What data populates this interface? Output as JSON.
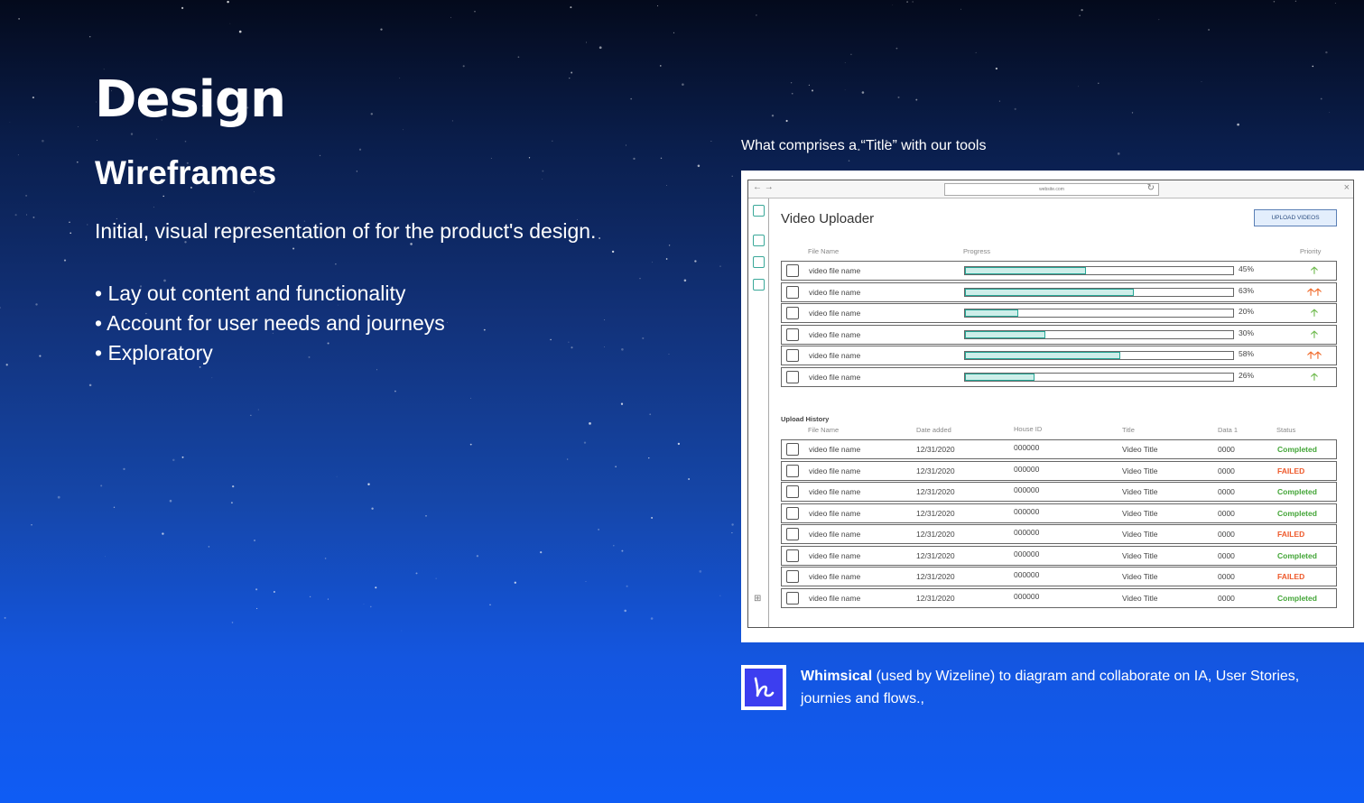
{
  "heading": "Design",
  "subheading": "Wireframes",
  "intro": "Initial, visual representation of for the product's design.",
  "bullets": [
    "• Lay out content and functionality",
    "• Account for user needs and journeys",
    "• Exploratory"
  ],
  "caption": "What comprises a “Title” with our tools",
  "wireframe": {
    "url": "website.com",
    "title": "Video Uploader",
    "upload_button": "UPLOAD VIDEOS",
    "upload_columns": {
      "file_name": "File Name",
      "progress": "Progress",
      "priority": "Priority"
    },
    "uploads": [
      {
        "file": "video file name",
        "progress": 45,
        "progress_label": "45%",
        "priority": "low"
      },
      {
        "file": "video file name",
        "progress": 63,
        "progress_label": "63%",
        "priority": "high"
      },
      {
        "file": "video file name",
        "progress": 20,
        "progress_label": "20%",
        "priority": "low"
      },
      {
        "file": "video file name",
        "progress": 30,
        "progress_label": "30%",
        "priority": "low"
      },
      {
        "file": "video file name",
        "progress": 58,
        "progress_label": "58%",
        "priority": "high"
      },
      {
        "file": "video file name",
        "progress": 26,
        "progress_label": "26%",
        "priority": "low"
      }
    ],
    "priority_glyphs": {
      "low": "🡡",
      "high": "🡡🡡"
    },
    "priority_colors": {
      "low": "#6fba4e",
      "high": "#f06a2a"
    },
    "history_label": "Upload History",
    "history_columns": {
      "file_name": "File Name",
      "date": "Date added",
      "house_id": "House ID",
      "title": "Title",
      "data": "Data 1",
      "status": "Status"
    },
    "history": [
      {
        "file": "video file name",
        "date": "12/31/2020",
        "house_id": "000000",
        "title": "Video Title",
        "data": "0000",
        "status": "Completed"
      },
      {
        "file": "video file name",
        "date": "12/31/2020",
        "house_id": "000000",
        "title": "Video Title",
        "data": "0000",
        "status": "FAILED"
      },
      {
        "file": "video file name",
        "date": "12/31/2020",
        "house_id": "000000",
        "title": "Video Title",
        "data": "0000",
        "status": "Completed"
      },
      {
        "file": "video file name",
        "date": "12/31/2020",
        "house_id": "000000",
        "title": "Video Title",
        "data": "0000",
        "status": "Completed"
      },
      {
        "file": "video file name",
        "date": "12/31/2020",
        "house_id": "000000",
        "title": "Video Title",
        "data": "0000",
        "status": "FAILED"
      },
      {
        "file": "video file name",
        "date": "12/31/2020",
        "house_id": "000000",
        "title": "Video Title",
        "data": "0000",
        "status": "Completed"
      },
      {
        "file": "video file name",
        "date": "12/31/2020",
        "house_id": "000000",
        "title": "Video Title",
        "data": "0000",
        "status": "FAILED"
      },
      {
        "file": "video file name",
        "date": "12/31/2020",
        "house_id": "000000",
        "title": "Video Title",
        "data": "0000",
        "status": "Completed"
      }
    ],
    "status_colors": {
      "Completed": "#43a537",
      "FAILED": "#ee5a2c"
    }
  },
  "tool_note": {
    "icon": "whimsical-logo-icon",
    "name": "Whimsical",
    "text": " (used by Wizeline) to diagram and collaborate on IA, User Stories, journies and flows.,"
  },
  "colors": {
    "accent_teal": "#25a796",
    "background_bottom": "#0f5cf5",
    "background_top": "#040a1c"
  }
}
